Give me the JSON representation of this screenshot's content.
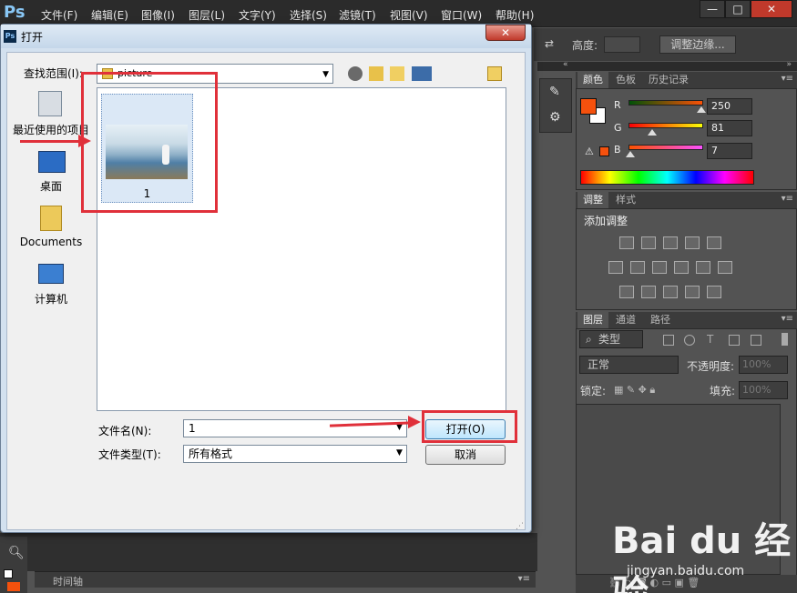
{
  "app": {
    "logo": "Ps",
    "menu": [
      "文件(F)",
      "编辑(E)",
      "图像(I)",
      "图层(L)",
      "文字(Y)",
      "选择(S)",
      "滤镜(T)",
      "视图(V)",
      "窗口(W)",
      "帮助(H)"
    ],
    "window_controls": [
      "—",
      "□",
      "✕"
    ]
  },
  "options_bar": {
    "height_label": "高度:",
    "refine_edge": "调整边缘..."
  },
  "color_panel": {
    "tabs": [
      "颜色",
      "色板",
      "历史记录"
    ],
    "foreground": "#f5510d",
    "channels": [
      {
        "label": "R",
        "value": "250",
        "fraction": 0.98
      },
      {
        "label": "G",
        "value": "81",
        "fraction": 0.32
      },
      {
        "label": "B",
        "value": "7",
        "fraction": 0.03
      }
    ]
  },
  "adjust_panel": {
    "tabs": [
      "调整",
      "样式"
    ],
    "add_label": "添加调整"
  },
  "layers_panel": {
    "tabs": [
      "图层",
      "通道",
      "路径"
    ],
    "kind_filter": "类型",
    "blend_mode": "正常",
    "opacity_label": "不透明度:",
    "opacity_value": "100%",
    "lock_label": "锁定:",
    "fill_label": "填充:",
    "fill_value": "100%"
  },
  "timeline": {
    "label": "时间轴"
  },
  "dialog": {
    "title": "打开",
    "close": "✕",
    "look_in_label": "查找范围(I):",
    "look_in_value": "picture",
    "places": [
      "最近使用的项目",
      "桌面",
      "Documents",
      "计算机"
    ],
    "file": {
      "name": "1"
    },
    "file_name_label": "文件名(N):",
    "file_name_value": "1",
    "file_type_label": "文件类型(T):",
    "file_type_value": "所有格式",
    "open_button": "打开(O)",
    "cancel_button": "取消"
  },
  "watermark": {
    "text": "Bai du 经验",
    "url": "jingyan.baidu.com"
  }
}
